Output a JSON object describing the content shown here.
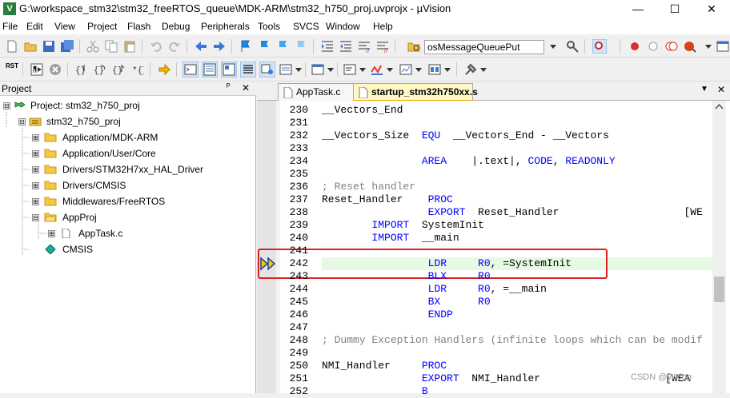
{
  "window": {
    "title": "G:\\workspace_stm32\\stm32_freeRTOS_queue\\MDK-ARM\\stm32_h750_proj.uvprojx - µVision",
    "minimize": "—",
    "maximize": "☐",
    "close": "✕"
  },
  "menu": [
    "File",
    "Edit",
    "View",
    "Project",
    "Flash",
    "Debug",
    "Peripherals",
    "Tools",
    "SVCS",
    "Window",
    "Help"
  ],
  "toolbar": {
    "find_combo": "osMessageQueuePut",
    "rst_label": "RST"
  },
  "project_panel": {
    "title": "Project",
    "pin": "ᴾ",
    "close": "✕",
    "tree": [
      {
        "label": "Project: stm32_h750_proj",
        "level": 0,
        "expander": "⊟",
        "icon": "project-icon"
      },
      {
        "label": "stm32_h750_proj",
        "level": 1,
        "expander": "⊟",
        "icon": "target-icon"
      },
      {
        "label": "Application/MDK-ARM",
        "level": 2,
        "expander": "⊞",
        "icon": "folder-icon"
      },
      {
        "label": "Application/User/Core",
        "level": 2,
        "expander": "⊞",
        "icon": "folder-icon"
      },
      {
        "label": "Drivers/STM32H7xx_HAL_Driver",
        "level": 2,
        "expander": "⊞",
        "icon": "folder-icon"
      },
      {
        "label": "Drivers/CMSIS",
        "level": 2,
        "expander": "⊞",
        "icon": "folder-icon"
      },
      {
        "label": "Middlewares/FreeRTOS",
        "level": 2,
        "expander": "⊞",
        "icon": "folder-icon"
      },
      {
        "label": "AppProj",
        "level": 2,
        "expander": "⊟",
        "icon": "folder-icon"
      },
      {
        "label": "AppTask.c",
        "level": 3,
        "expander": "⊞",
        "icon": "file-icon"
      },
      {
        "label": "CMSIS",
        "level": 2,
        "expander": "",
        "icon": "gear-diamond-icon"
      }
    ]
  },
  "editor": {
    "tabs": [
      {
        "label": "AppTask.c",
        "active": false
      },
      {
        "label": "startup_stm32h750xx.s",
        "active": true
      }
    ],
    "tab_menu": "▼",
    "tab_close": "✕",
    "lines": [
      {
        "num": "230",
        "text": "__Vectors_End"
      },
      {
        "num": "231",
        "text": ""
      },
      {
        "num": "232",
        "text": "__Vectors_Size  EQU  __Vectors_End - __Vectors"
      },
      {
        "num": "233",
        "text": ""
      },
      {
        "num": "234",
        "text": "                AREA    |.text|, CODE, READONLY"
      },
      {
        "num": "235",
        "text": ""
      },
      {
        "num": "236",
        "text": "; Reset handler"
      },
      {
        "num": "237",
        "text": "Reset_Handler    PROC"
      },
      {
        "num": "238",
        "text": "                 EXPORT  Reset_Handler                    [WE"
      },
      {
        "num": "239",
        "text": "        IMPORT  SystemInit"
      },
      {
        "num": "240",
        "text": "        IMPORT  __main"
      },
      {
        "num": "241",
        "text": ""
      },
      {
        "num": "242",
        "text": "                 LDR     R0, =SystemInit"
      },
      {
        "num": "243",
        "text": "                 BLX     R0"
      },
      {
        "num": "244",
        "text": "                 LDR     R0, =__main"
      },
      {
        "num": "245",
        "text": "                 BX      R0"
      },
      {
        "num": "246",
        "text": "                 ENDP"
      },
      {
        "num": "247",
        "text": ""
      },
      {
        "num": "248",
        "text": "; Dummy Exception Handlers (infinite loops which can be modif"
      },
      {
        "num": "249",
        "text": ""
      },
      {
        "num": "250",
        "text": "NMI_Handler     PROC"
      },
      {
        "num": "251",
        "text": "                EXPORT  NMI_Handler                    [WEA"
      },
      {
        "num": "252",
        "text": "                B"
      }
    ],
    "current_line": "242"
  },
  "watermark": "CSDN @Wxlog"
}
